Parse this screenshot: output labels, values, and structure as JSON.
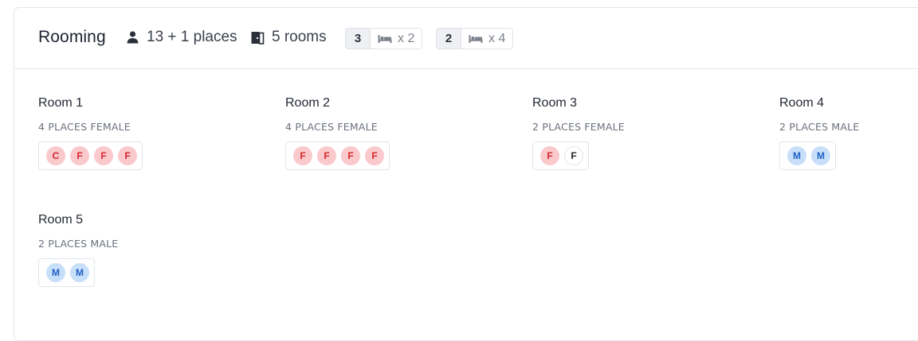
{
  "header": {
    "title": "Rooming",
    "places_label": "13 + 1 places",
    "rooms_label": "5 rooms",
    "room_types": [
      {
        "count": "3",
        "beds": "x 2"
      },
      {
        "count": "2",
        "beds": "x 4"
      }
    ]
  },
  "icons": {
    "person": "person-icon",
    "door": "door-icon",
    "bed": "bed-icon"
  },
  "colors": {
    "female_bg": "#f9c9cc",
    "female_text": "#d6262f",
    "male_bg": "#c8dff9",
    "male_text": "#1f60c4"
  },
  "rooms": [
    {
      "name": "Room 1",
      "subtitle": "4 PLACES FEMALE",
      "slots": [
        {
          "label": "C",
          "kind": "female"
        },
        {
          "label": "F",
          "kind": "female"
        },
        {
          "label": "F",
          "kind": "female"
        },
        {
          "label": "F",
          "kind": "female"
        }
      ]
    },
    {
      "name": "Room 2",
      "subtitle": "4 PLACES FEMALE",
      "slots": [
        {
          "label": "F",
          "kind": "female"
        },
        {
          "label": "F",
          "kind": "female"
        },
        {
          "label": "F",
          "kind": "female"
        },
        {
          "label": "F",
          "kind": "female"
        }
      ]
    },
    {
      "name": "Room 3",
      "subtitle": "2 PLACES FEMALE",
      "slots": [
        {
          "label": "F",
          "kind": "female"
        },
        {
          "label": "F",
          "kind": "empty"
        }
      ]
    },
    {
      "name": "Room 4",
      "subtitle": "2 PLACES MALE",
      "slots": [
        {
          "label": "M",
          "kind": "male"
        },
        {
          "label": "M",
          "kind": "male"
        }
      ]
    },
    {
      "name": "Room 5",
      "subtitle": "2 PLACES MALE",
      "slots": [
        {
          "label": "M",
          "kind": "male"
        },
        {
          "label": "M",
          "kind": "male"
        }
      ]
    }
  ]
}
